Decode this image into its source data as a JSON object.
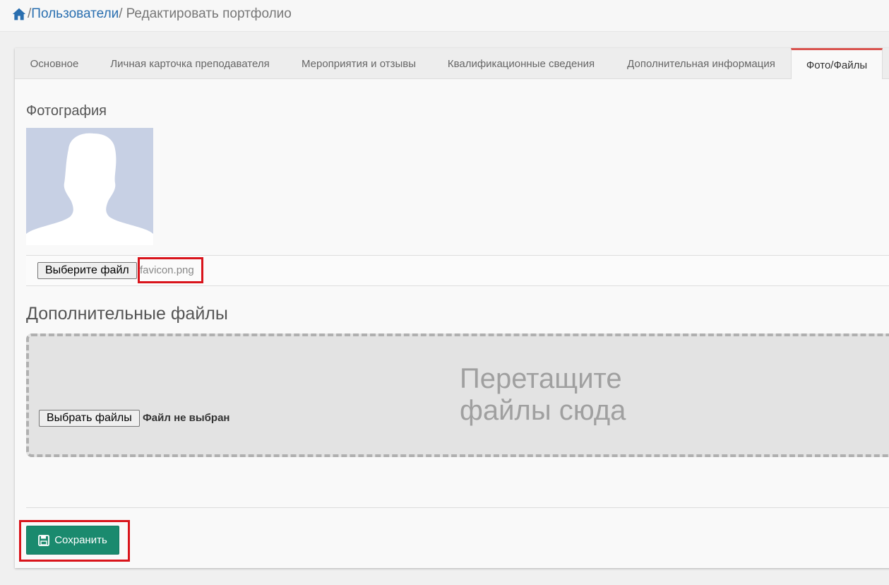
{
  "breadcrumb": {
    "home_icon": "home-icon",
    "sep1": "/",
    "users": "Пользователи",
    "sep2": "/",
    "current": "Редактировать портфолио"
  },
  "tabs": [
    {
      "label": "Основное",
      "active": false
    },
    {
      "label": "Личная карточка преподавателя",
      "active": false
    },
    {
      "label": "Мероприятия и отзывы",
      "active": false
    },
    {
      "label": "Квалификационные сведения",
      "active": false
    },
    {
      "label": "Дополнительная информация",
      "active": false
    },
    {
      "label": "Фото/Файлы",
      "active": true
    }
  ],
  "photo_section": {
    "title": "Фотография",
    "avatar_icon": "avatar-silhouette-icon",
    "choose_button": "Выберите файл",
    "selected_file": "favicon.png"
  },
  "files_section": {
    "title": "Дополнительные файлы",
    "choose_button": "Выбрать файлы",
    "no_file_text": "Файл не выбран",
    "drop_line1": "Перетащите",
    "drop_line2": "файлы сюда"
  },
  "save_button": {
    "label": "Сохранить",
    "icon": "floppy-disk-icon"
  },
  "colors": {
    "accent_tab": "#d9534f",
    "link": "#2a6fb0",
    "save_bg": "#1a8a6e",
    "highlight": "#d9141b"
  }
}
